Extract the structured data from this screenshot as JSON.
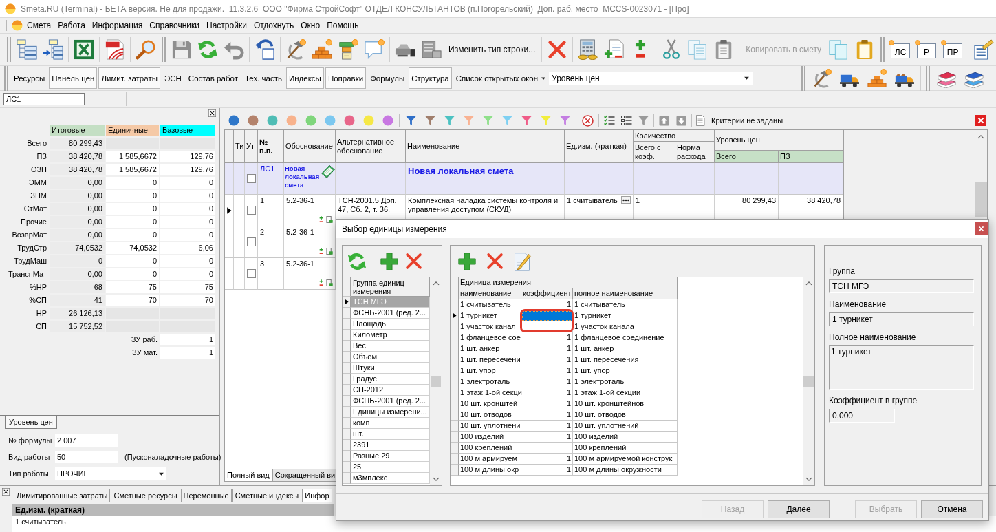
{
  "window": {
    "title": "Smeta.RU (Terminal) - БЕТА версия. Не для продажи.  11.3.2.6  ООО \"Фирма СтройСофт\" ОТДЕЛ КОНСУЛЬТАНТОВ (п.Погорельский)  Доп. раб. место  MCCS-0023071 - [Про]"
  },
  "menu": [
    "Смета",
    "Работа",
    "Информация",
    "Справочники",
    "Настройки",
    "Отдохнуть",
    "Окно",
    "Помощь"
  ],
  "toolbar": {
    "change_row_type": "Изменить тип строки...",
    "copy_to_estimate": {
      "label": "Копировать в смету",
      "disabled": true
    },
    "estimate_buttons": [
      "ЛС",
      "Р",
      "ПР"
    ]
  },
  "panel_bar": {
    "buttons": [
      {
        "label": "Ресурсы",
        "pressed": false
      },
      {
        "label": "Панель цен",
        "pressed": true
      },
      {
        "label": "Лимит. затраты",
        "pressed": true
      },
      {
        "label": "ЭСН",
        "pressed": false
      },
      {
        "label": "Состав работ",
        "pressed": false
      },
      {
        "label": "Тех. часть",
        "pressed": false
      },
      {
        "label": "Индексы",
        "pressed": true
      },
      {
        "label": "Поправки",
        "pressed": true
      },
      {
        "label": "Формулы",
        "pressed": false
      },
      {
        "label": "Структура",
        "pressed": true
      }
    ],
    "open_windows": "Список открытых окон",
    "price_level": {
      "value": "Уровень цен"
    }
  },
  "address": {
    "value": "ЛС1"
  },
  "price_panel": {
    "columns": [
      {
        "label": "Итоговые",
        "color": "#c4dfc4"
      },
      {
        "label": "Единичные",
        "color": "#f5c9a6"
      },
      {
        "label": "Базовые",
        "color": "#00ffff"
      }
    ],
    "rows": [
      {
        "label": "Всего",
        "total": "80 299,43"
      },
      {
        "label": "ПЗ",
        "total": "38 420,78",
        "unit": "1 585,6672",
        "base": "129,76"
      },
      {
        "label": "ОЗП",
        "total": "38 420,78",
        "unit": "1 585,6672",
        "base": "129,76"
      },
      {
        "label": "ЭММ",
        "total": "0,00",
        "unit": "0",
        "base": "0"
      },
      {
        "label": "ЗПМ",
        "total": "0,00",
        "unit": "0",
        "base": "0"
      },
      {
        "label": "СтМат",
        "total": "0,00",
        "unit": "0",
        "base": "0"
      },
      {
        "label": "Прочие",
        "total": "0,00",
        "unit": "0",
        "base": "0"
      },
      {
        "label": "ВозврМат",
        "total": "0,00",
        "unit": "0",
        "base": "0"
      },
      {
        "label": "ТрудСтр",
        "total": "74,0532",
        "unit": "74,0532",
        "base": "6,06"
      },
      {
        "label": "ТрудМаш",
        "total": "0",
        "unit": "0",
        "base": "0"
      },
      {
        "label": "ТранспМат",
        "total": "0,00",
        "unit": "0",
        "base": "0"
      },
      {
        "label": "%НР",
        "total": "68",
        "unit": "75",
        "base": "75"
      },
      {
        "label": "%СП",
        "total": "41",
        "unit": "70",
        "base": "70"
      },
      {
        "label": "НР",
        "total": "26 126,13"
      },
      {
        "label": "СП",
        "total": "15 752,52"
      }
    ],
    "factors": [
      {
        "label": "ЗУ раб.",
        "value": "1"
      },
      {
        "label": "ЗУ мат.",
        "value": "1"
      }
    ],
    "tabs": [
      {
        "label": "Уровень цен",
        "selected": true
      }
    ],
    "form": {
      "formula": {
        "label": "№ формулы",
        "value": "2 007"
      },
      "work_kind": {
        "label": "Вид работы",
        "value": "50",
        "note": "(Пусконаладочные работы)"
      },
      "work_type": {
        "label": "Тип работы",
        "value": "ПРОЧИЕ"
      }
    }
  },
  "document": {
    "color_filters": [
      {
        "color": "#2f77c9"
      },
      {
        "color": "#b4836c"
      },
      {
        "color": "#4fbdb5"
      },
      {
        "color": "#f8b28c"
      },
      {
        "color": "#80d67c"
      },
      {
        "color": "#7cc8f0"
      },
      {
        "color": "#e8668a"
      },
      {
        "color": "#f6e846"
      },
      {
        "color": "#c878e2"
      }
    ],
    "funnel_filters": [
      {
        "color": "#2f6fc8"
      },
      {
        "color": "#a07e6c"
      },
      {
        "color": "#4cc2c2"
      },
      {
        "color": "#f9b292"
      },
      {
        "color": "#8fe08a"
      },
      {
        "color": "#7ed0f2"
      },
      {
        "color": "#f05c88"
      },
      {
        "color": "#f2ee3c"
      },
      {
        "color": "#c47ee2"
      }
    ],
    "criteria": "Критерии не заданы",
    "table": {
      "columns": [
        "Ти",
        "Ут",
        "№ п.п.",
        "Обоснование",
        "Альтернативное обоснование",
        "Наименование",
        "Ед.изм. (краткая)"
      ],
      "groups": [
        {
          "label": "Количество",
          "columns": [
            "Всего с коэф.",
            "Норма расхода"
          ]
        },
        {
          "label": "Уровень цен",
          "columns": [
            "Всего",
            "ПЗ"
          ]
        }
      ],
      "rows": [
        {
          "kind": "section",
          "selected": false,
          "checked": false,
          "number": "ЛС1",
          "basis": "Новая локальная смета",
          "name": "Новая локальная смета"
        },
        {
          "kind": "item",
          "selected": true,
          "checked": false,
          "number": "1",
          "basis": "5.2-36-1",
          "alt_basis": "ТСН-2001.5 Доп. 47, Сб. 2, т. 36,",
          "name": "Комплексная наладка системы контроля и управления доступом (СКУД)",
          "unit": "1 считыватель",
          "quantity": "1",
          "total": "80 299,43",
          "labor": "38 420,78"
        },
        {
          "kind": "item",
          "selected": false,
          "checked": false,
          "number": "2",
          "basis": "5.2-36-1"
        },
        {
          "kind": "item",
          "selected": false,
          "checked": false,
          "number": "3",
          "basis": "5.2-36-1"
        }
      ]
    },
    "view_tabs": [
      {
        "label": "Полный вид",
        "selected": true
      },
      {
        "label": "Сокращенный ви",
        "selected": false
      }
    ]
  },
  "bottom_panel": {
    "tabs": [
      {
        "label": "Лимитированные затраты",
        "selected": false
      },
      {
        "label": "Сметные ресурсы",
        "selected": false
      },
      {
        "label": "Переменные",
        "selected": false
      },
      {
        "label": "Сметные индексы",
        "selected": false
      },
      {
        "label": "Инфор",
        "selected": true
      }
    ],
    "column": "Ед.изм. (краткая)",
    "value": "1 считыватель"
  },
  "dialog": {
    "title": "Выбор единицы измерения",
    "groups": {
      "header": "Группа единиц измерения",
      "items": [
        {
          "label": "ТСН МГЭ",
          "selected": true
        },
        {
          "label": "ФСНБ-2001 (ред. 2...",
          "selected": false
        },
        {
          "label": "Площадь",
          "selected": false
        },
        {
          "label": "Километр",
          "selected": false
        },
        {
          "label": "Вес",
          "selected": false
        },
        {
          "label": "Объем",
          "selected": false
        },
        {
          "label": "Штуки",
          "selected": false
        },
        {
          "label": "Градус",
          "selected": false
        },
        {
          "label": "СН-2012",
          "selected": false
        },
        {
          "label": "ФСНБ-2001 (ред. 2...",
          "selected": false
        },
        {
          "label": "Единицы измерени...",
          "selected": false
        },
        {
          "label": "комп",
          "selected": false
        },
        {
          "label": "шт.",
          "selected": false
        },
        {
          "label": "2391",
          "selected": false
        },
        {
          "label": "Разные 29",
          "selected": false
        },
        {
          "label": "25",
          "selected": false
        },
        {
          "label": "м3мплекс",
          "selected": false
        }
      ]
    },
    "units": {
      "header": "Единица измерения",
      "columns": [
        "наименование",
        "коэффициент",
        "полное наименование"
      ],
      "rows": [
        {
          "name": "1 считыватель",
          "factor": "1",
          "full_name": "1 считыватель",
          "selected": false
        },
        {
          "name": "1 турникет",
          "full_name": "1 турникет",
          "selected": true
        },
        {
          "name": "1 участок канал",
          "full_name": "1 участок канала",
          "selected": false
        },
        {
          "name": "1 фланцевое сое",
          "factor": "1",
          "full_name": "1 фланцевое соединение",
          "selected": false
        },
        {
          "name": "1 шт. анкер",
          "factor": "1",
          "full_name": "1 шт. анкер",
          "selected": false
        },
        {
          "name": "1 шт. пересечени",
          "factor": "1",
          "full_name": "1 шт. пересечения",
          "selected": false
        },
        {
          "name": "1 шт. упор",
          "factor": "1",
          "full_name": "1 шт. упор",
          "selected": false
        },
        {
          "name": "1 электроталь",
          "factor": "1",
          "full_name": "1 электроталь",
          "selected": false
        },
        {
          "name": "1 этаж 1-ой секци",
          "factor": "1",
          "full_name": "1 этаж 1-ой секции",
          "selected": false
        },
        {
          "name": "10 шт. кронштей",
          "factor": "1",
          "full_name": "10 шт. кронштейнов",
          "selected": false
        },
        {
          "name": "10 шт. отводов",
          "factor": "1",
          "full_name": "10 шт. отводов",
          "selected": false
        },
        {
          "name": "10 шт. уплотнени",
          "factor": "1",
          "full_name": "10 шт. уплотнений",
          "selected": false
        },
        {
          "name": "100 изделий",
          "factor": "1",
          "full_name": "100 изделий",
          "selected": false
        },
        {
          "name": "100 креплений",
          "full_name": "100 креплений",
          "selected": false
        },
        {
          "name": "100 м армируем",
          "factor": "1",
          "full_name": "100 м армируемой конструк",
          "selected": false
        },
        {
          "name": "100 м длины окр",
          "factor": "1",
          "full_name": "100 м длины окружности",
          "selected": false
        }
      ]
    },
    "details": [
      {
        "kind": "line",
        "label": "Группа",
        "value": "ТСН МГЭ"
      },
      {
        "kind": "line",
        "label": "Наименование",
        "value": "1 турникет"
      },
      {
        "kind": "area",
        "label": "Полное наименование",
        "value": "1 турникет"
      },
      {
        "kind": "short",
        "label": "Коэффициент в группе",
        "value": "0,000"
      }
    ],
    "buttons": [
      {
        "label": "Назад",
        "disabled": true
      },
      {
        "label": "Далее",
        "disabled": false
      },
      {
        "label": "Выбрать",
        "disabled": true
      },
      {
        "label": "Отмена",
        "disabled": false
      }
    ]
  }
}
